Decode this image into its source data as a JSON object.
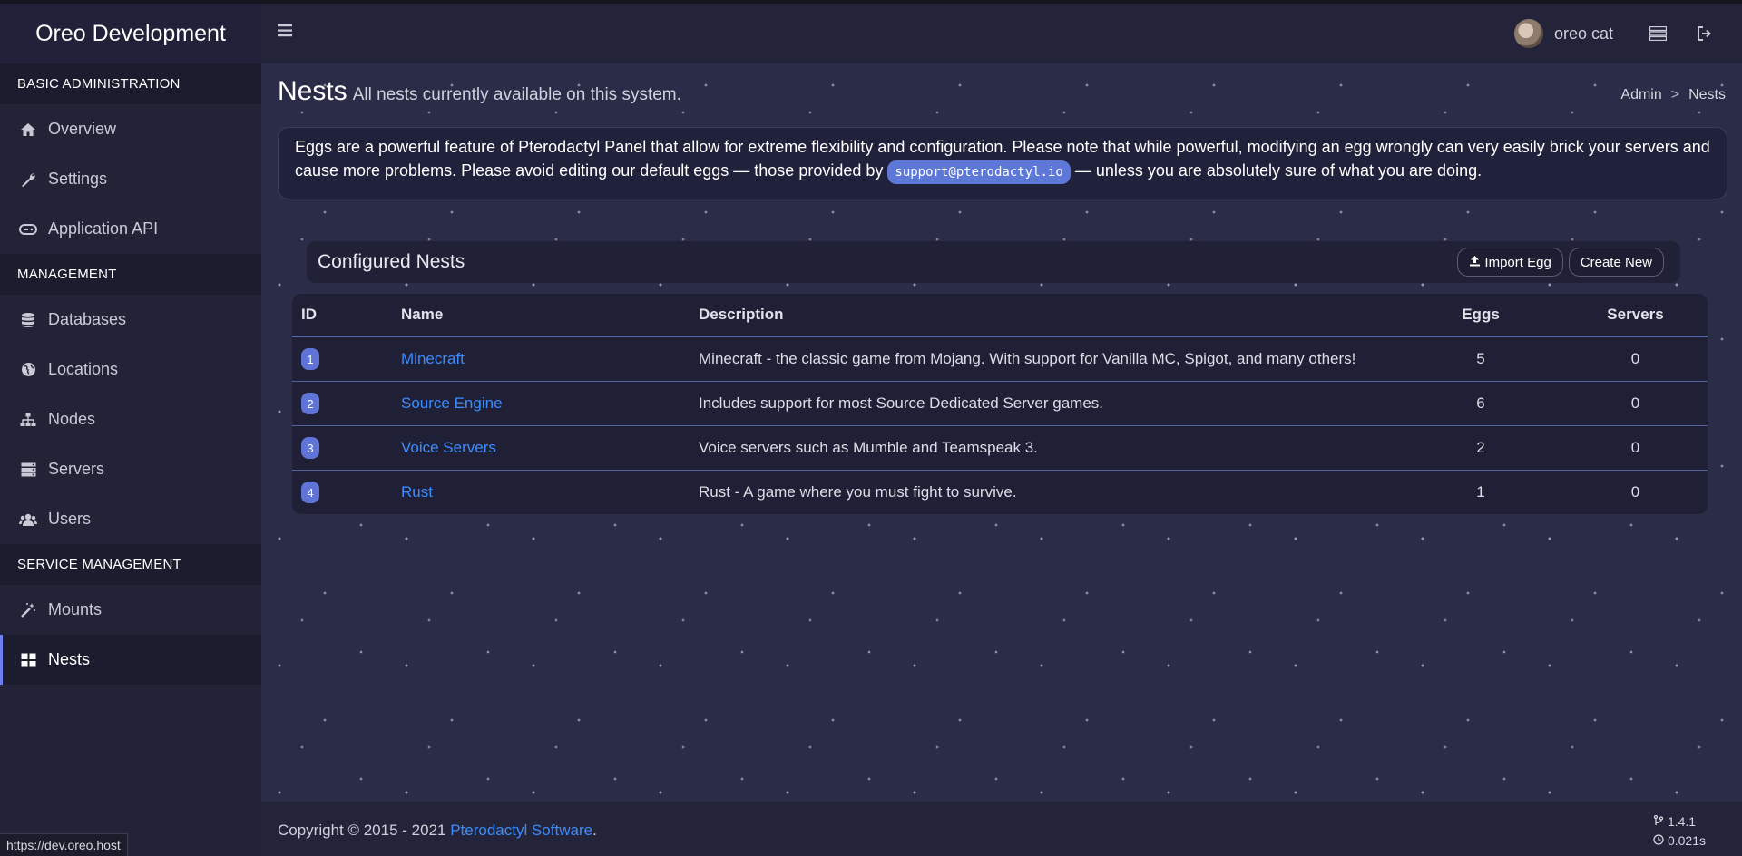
{
  "app": {
    "brand": "Oreo Development"
  },
  "colors": {
    "accent": "#6d7ff0",
    "link": "#3c8cff",
    "badge": "#6074d8"
  },
  "sidebar": {
    "sections": [
      {
        "header": "BASIC ADMINISTRATION",
        "items": [
          {
            "label": "Overview",
            "icon": "home-icon"
          },
          {
            "label": "Settings",
            "icon": "wrench-icon"
          },
          {
            "label": "Application API",
            "icon": "gamepad-icon"
          }
        ]
      },
      {
        "header": "MANAGEMENT",
        "items": [
          {
            "label": "Databases",
            "icon": "database-icon"
          },
          {
            "label": "Locations",
            "icon": "globe-icon"
          },
          {
            "label": "Nodes",
            "icon": "sitemap-icon"
          },
          {
            "label": "Servers",
            "icon": "server-icon"
          },
          {
            "label": "Users",
            "icon": "users-icon"
          }
        ]
      },
      {
        "header": "SERVICE MANAGEMENT",
        "items": [
          {
            "label": "Mounts",
            "icon": "magic-icon"
          },
          {
            "label": "Nests",
            "icon": "grid-icon",
            "active": true
          }
        ]
      }
    ]
  },
  "statusbar": {
    "url": "https://dev.oreo.host"
  },
  "topbar": {
    "username": "oreo cat"
  },
  "header": {
    "title": "Nests",
    "subtitle": "All nests currently available on this system."
  },
  "breadcrumb": {
    "root": "Admin",
    "sep": ">",
    "current": "Nests"
  },
  "alert": {
    "text_before": "Eggs are a powerful feature of Pterodactyl Panel that allow for extreme flexibility and configuration. Please note that while powerful, modifying an egg wrongly can very easily brick your servers and cause more problems. Please avoid editing our default eggs — those provided by ",
    "code": "support@pterodactyl.io",
    "text_after": " — unless you are absolutely sure of what you are doing."
  },
  "box": {
    "title": "Configured Nests",
    "import_label": "Import Egg",
    "create_label": "Create New"
  },
  "table": {
    "columns": {
      "id": "ID",
      "name": "Name",
      "description": "Description",
      "eggs": "Eggs",
      "servers": "Servers"
    },
    "rows": [
      {
        "id": "1",
        "name": "Minecraft",
        "description": "Minecraft - the classic game from Mojang. With support for Vanilla MC, Spigot, and many others!",
        "eggs": "5",
        "servers": "0"
      },
      {
        "id": "2",
        "name": "Source Engine",
        "description": "Includes support for most Source Dedicated Server games.",
        "eggs": "6",
        "servers": "0"
      },
      {
        "id": "3",
        "name": "Voice Servers",
        "description": "Voice servers such as Mumble and Teamspeak 3.",
        "eggs": "2",
        "servers": "0"
      },
      {
        "id": "4",
        "name": "Rust",
        "description": "Rust - A game where you must fight to survive.",
        "eggs": "1",
        "servers": "0"
      }
    ]
  },
  "footer": {
    "copyright_prefix": "Copyright © 2015 - 2021 ",
    "company": "Pterodactyl Software",
    "suffix": ".",
    "version": "1.4.1",
    "time": "0.021s"
  }
}
